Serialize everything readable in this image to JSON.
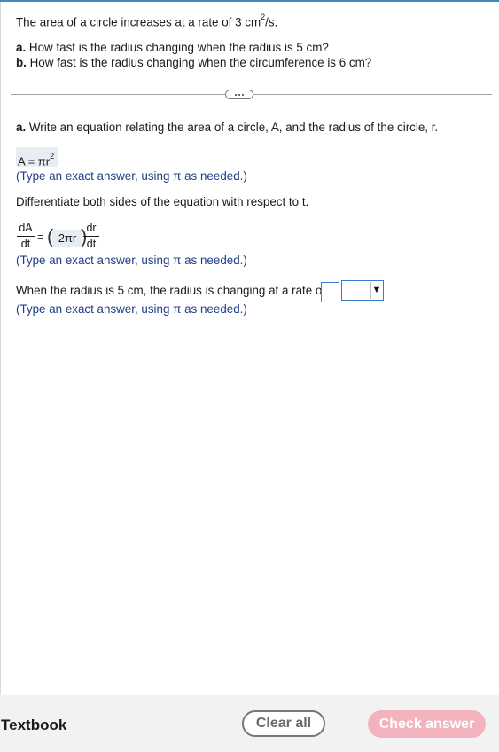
{
  "problem": {
    "statement_prefix": "The area of a circle increases at a rate of 3 cm",
    "statement_exp": "2",
    "statement_suffix": "/s.",
    "part_a_label": "a.",
    "part_a_text": "How fast is the radius changing when the radius is 5 cm?",
    "part_b_label": "b.",
    "part_b_text": "How fast is the radius changing when the circumference is 6 cm?"
  },
  "step1": {
    "label": "a.",
    "text": "Write an equation relating the area of a circle, A, and the radius of the circle, r.",
    "answer_base": "A = πr",
    "answer_exp": "2",
    "hint": "(Type an exact answer, using π as needed.)"
  },
  "step2": {
    "text": "Differentiate both sides of the equation with respect to t.",
    "lhs_num": "dA",
    "lhs_den": "dt",
    "equals": "=",
    "paren_open": "(",
    "answer": "2πr",
    "paren_close": ")",
    "rhs_num": "dr",
    "rhs_den": "dt",
    "hint": "(Type an exact answer, using π as needed.)"
  },
  "step3": {
    "text": "When the radius is 5 cm, the radius is changing at a rate of",
    "input_value": "",
    "unit_selected": "",
    "hint": "(Type an exact answer, using π as needed.)"
  },
  "footer": {
    "textbook_label": "Textbook",
    "clear_label": "Clear all",
    "check_label": "Check answer"
  },
  "icons": {
    "expand": "ellipsis-icon",
    "dropdown": "triangle-down-icon"
  },
  "colors": {
    "accent": "#3c8fb4",
    "hint_text": "#1f3e86",
    "check_button": "#f3b3bd",
    "input_border": "#3a7dd0"
  }
}
